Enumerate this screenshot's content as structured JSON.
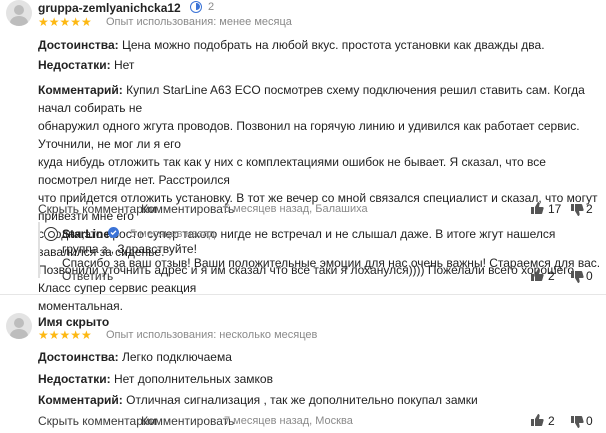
{
  "review1": {
    "username": "gruppa-zemlyanichcka12",
    "stars": "★★★★★",
    "experience": "Опыт использования: менее месяца",
    "count": "2",
    "dostoinstva_label": "Достоинства:",
    "dostoinstva": "Цена можно подобрать на любой вкус. простота установки как дважды два.",
    "nedostatki_label": "Недостатки:",
    "nedostatki": "Нет",
    "comment_label": "Комментарий:",
    "comment_lines": [
      "Купил StarLine A63 ECO посмотрев схему подключения решил ставить сам. Когда начал собирать не",
      "обнаружил одного жгута проводов. Позвонил на горячую линию и удивился как работает сервис. Уточнили, не мог ли я его",
      "куда нибудь отложить так как у них с комплектациями ошибок не бывает. Я сказал, что все посмотрел нигде нет. Расстроился",
      "что прийдется отложить установку. В тот же вечер со мной связался специалист и сказал, что могут привезти мне его",
      "сегодня,это просто супер такого нигде не встречал и не слышал даже. В итоге жгут нашелся завалился за сиденье.",
      "Позвонили уточнить адрес и я им сказал что все таки я лоханулся)))) Пожелали всего хорошего. Класс супер сервис реакция",
      "моментальная."
    ],
    "hide_comments": "Скрыть комментарии",
    "comment_action": "Комментировать",
    "footer_meta": "5 месяцев назад, Балашиха",
    "likes": "17",
    "dislikes": "2"
  },
  "reply": {
    "author": "StarLine",
    "time": "5 месяцев назад",
    "line1": "группа з., Здравствуйте!",
    "line2": "Спасибо за ваш отзыв! Ваши положительные эмоции для нас очень важны! Стараемся для вас.",
    "reply_action": "Ответить",
    "likes": "2",
    "dislikes": "0"
  },
  "review2": {
    "username": "Имя скрыто",
    "stars": "★★★★★",
    "experience": "Опыт использования: несколько месяцев",
    "dostoinstva_label": "Достоинства:",
    "dostoinstva": "Легко подключаема",
    "nedostatki_label": "Недостатки:",
    "nedostatki": "Нет дополнительных замков",
    "comment_label": "Комментарий:",
    "comment": "Отличная сигнализация , так же дополнительно покупал замки",
    "hide_comments": "Скрыть комментарии",
    "comment_action": "Комментировать",
    "footer_meta": "7 месяцев назад, Москва",
    "likes": "2",
    "dislikes": "0"
  },
  "icons": {
    "thumb_up": "thumb-up-icon",
    "thumb_down": "thumb-down-icon",
    "more": "more-icon",
    "avatar": "avatar-icon"
  },
  "colors": {
    "star": "#fdb813",
    "badge": "#3b73d6",
    "divider": "#e6e6e6"
  }
}
